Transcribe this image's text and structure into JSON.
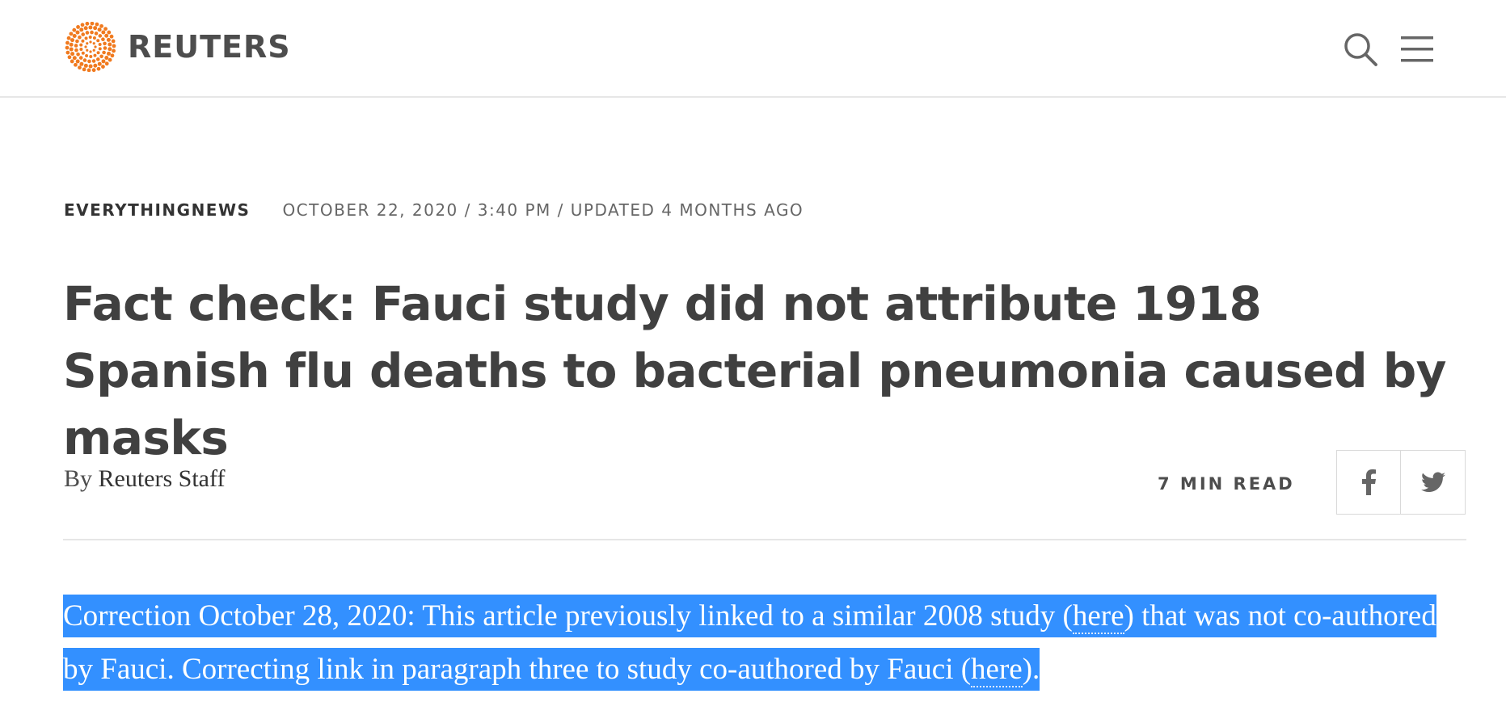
{
  "header": {
    "logo_text": "REUTERS",
    "search_icon": "search-icon",
    "menu_icon": "hamburger-menu-icon"
  },
  "article": {
    "channel": "EVERYTHINGNEWS",
    "dateline": "OCTOBER 22, 2020 / 3:40 PM / UPDATED 4 MONTHS AGO",
    "headline": "Fact check: Fauci study did not attribute 1918 Spanish flu deaths to bacterial pneumonia caused by masks",
    "byline_prefix": "By",
    "author": "Reuters Staff",
    "read_time": "7 MIN READ",
    "share": {
      "facebook_icon": "facebook-icon",
      "twitter_icon": "twitter-icon"
    },
    "correction": {
      "part1": "Correction October 28, 2020: This article previously linked to a similar 2008 study (",
      "link1": "here",
      "part2": ") that was not co-authored by Fauci. Correcting link in paragraph three to study co-authored by Fauci (",
      "link2": "here",
      "part3": ")."
    }
  },
  "colors": {
    "brand_orange": "#f07a1f",
    "text_dark": "#404040",
    "selection_blue": "#3390ff"
  }
}
